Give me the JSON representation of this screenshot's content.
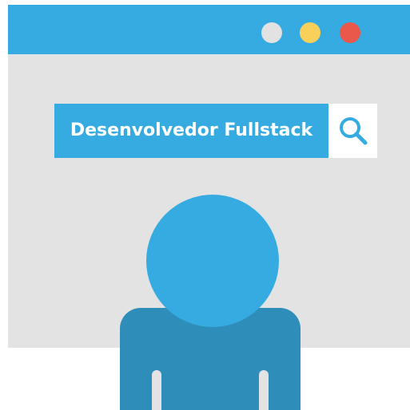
{
  "browser": {
    "title_bar_color": "#35abe1",
    "background_color": "#e3e3e3",
    "window_controls": [
      {
        "name": "gray-dot",
        "color": "#e2e2e2"
      },
      {
        "name": "yellow-dot",
        "color": "#f9d15a"
      },
      {
        "name": "red-dot",
        "color": "#e9584b"
      }
    ]
  },
  "search": {
    "query": "Desenvolvedor Fullstack",
    "icon": "search-icon",
    "bar_color": "#35abe1",
    "icon_color": "#35abe1"
  },
  "person": {
    "icon": "user-silhouette-icon",
    "head_color": "#35abe1",
    "body_color": "#2f8dba"
  }
}
